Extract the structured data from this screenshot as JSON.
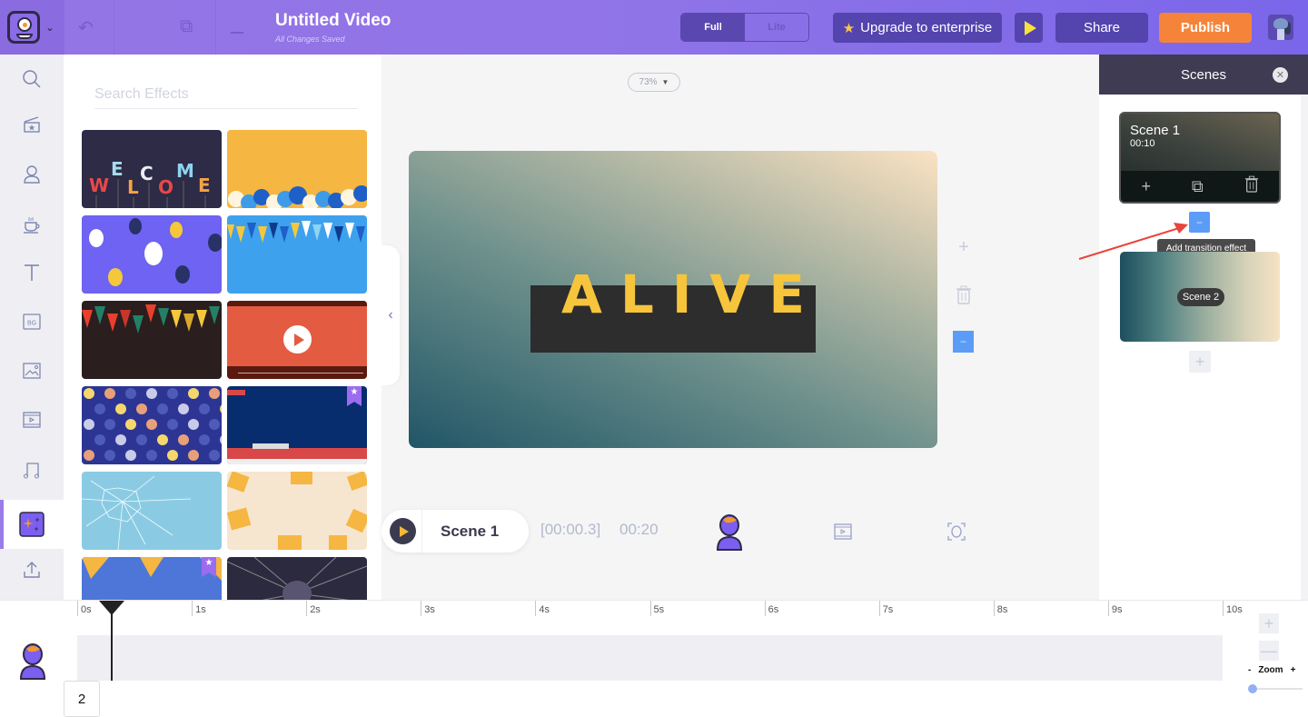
{
  "header": {
    "title": "Untitled Video",
    "save_status": "All Changes Saved",
    "mode_toggle": {
      "options": [
        "Full",
        "Lite"
      ],
      "selected": "Full"
    },
    "upgrade_label": "Upgrade to enterprise",
    "share_label": "Share",
    "publish_label": "Publish",
    "icons": [
      "logo-icon",
      "chevron-down-icon",
      "undo-icon",
      "duplicate-icon",
      "redo-icon",
      "play-icon",
      "user-avatar"
    ]
  },
  "sidebar": {
    "items": [
      {
        "name": "search",
        "icon": "search-icon"
      },
      {
        "name": "templates",
        "icon": "clapperboard-icon"
      },
      {
        "name": "characters",
        "icon": "character-icon"
      },
      {
        "name": "props",
        "icon": "coffee-cup-icon"
      },
      {
        "name": "text",
        "icon": "text-icon"
      },
      {
        "name": "backgrounds",
        "icon": "bg-icon",
        "label": "BG"
      },
      {
        "name": "images",
        "icon": "image-icon"
      },
      {
        "name": "videos",
        "icon": "video-icon"
      },
      {
        "name": "music",
        "icon": "music-note-icon"
      },
      {
        "name": "effects",
        "icon": "sparkle-icon",
        "active": true
      },
      {
        "name": "upload",
        "icon": "upload-icon"
      }
    ]
  },
  "effects_panel": {
    "search_placeholder": "Search Effects",
    "items": [
      {
        "name": "welcome-balloons"
      },
      {
        "name": "balloons-orange"
      },
      {
        "name": "balloons-purple"
      },
      {
        "name": "bunting-blue"
      },
      {
        "name": "bunting-dark"
      },
      {
        "name": "video-player"
      },
      {
        "name": "polka-dots"
      },
      {
        "name": "breaking-news",
        "premium": true
      },
      {
        "name": "cracked-glass"
      },
      {
        "name": "coffee-cups"
      },
      {
        "name": "pizza-slices",
        "premium": true
      },
      {
        "name": "speed-lines"
      }
    ]
  },
  "canvas": {
    "zoom": "73%",
    "headline": "ALIVE",
    "side_tools": [
      "add-icon",
      "trash-icon",
      "minus-icon"
    ]
  },
  "playbar": {
    "scene_label": "Scene 1",
    "current_time": "[00:00.3]",
    "total_time": "00:20"
  },
  "scenes_panel": {
    "title": "Scenes",
    "scenes": [
      {
        "name": "Scene 1",
        "duration": "00:10",
        "selected": true
      },
      {
        "name": "Scene 2"
      }
    ],
    "tooltip": "Add transition effect"
  },
  "timeline": {
    "ticks": [
      "0s",
      "1s",
      "2s",
      "3s",
      "4s",
      "5s",
      "6s",
      "7s",
      "8s",
      "9s",
      "10s"
    ],
    "playhead_seconds": 0.3,
    "layer_count": "2",
    "zoom_label": "Zoom",
    "zoom_minus": "-",
    "zoom_plus": "+",
    "zoom_level": 0
  },
  "colors": {
    "accent": "#8f74e8",
    "publish": "#f5843a",
    "transition": "#5b9cf7",
    "headline": "#f7c53c"
  }
}
